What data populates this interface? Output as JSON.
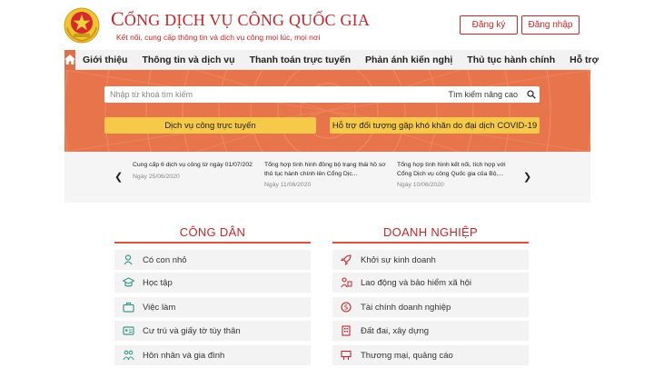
{
  "header": {
    "title_first": "C",
    "title_rest": "ỔNG DỊCH VỤ CÔNG QUỐC GIA",
    "subtitle": "Kết nối, cung cấp thông tin và dịch vụ công mọi lúc, mọi nơi",
    "register_label": "Đăng ký",
    "login_label": "Đăng nhập"
  },
  "nav": {
    "items": [
      "Giới thiệu",
      "Thông tin và dịch vụ",
      "Thanh toán trực tuyến",
      "Phản ánh kiến nghị",
      "Thủ tục hành chính",
      "Hỗ trợ"
    ]
  },
  "search": {
    "placeholder": "Nhập từ khoá tìm kiếm",
    "advanced_label": "Tìm kiếm nâng cao"
  },
  "hero_buttons": [
    "Dịch vụ công trực tuyến",
    "Hỗ trợ đối tượng gặp khó khăn do đại dịch COVID-19"
  ],
  "news": [
    {
      "title": "Cung cấp 6 dịch vụ công từ ngày 01/07/202",
      "date": "Ngày 25/06/2020"
    },
    {
      "title": "Tổng hợp tình hình đồng bộ trạng thái hồ sơ thủ tục hành chính lên Cổng Dịc...",
      "date": "Ngày 11/06/2020"
    },
    {
      "title": "Tổng hợp tình hình kết nối, tích hợp với Cổng Dịch vụ công Quốc gia của Bộ,...",
      "date": "Ngày 10/06/2020"
    }
  ],
  "citizen": {
    "title": "CÔNG DÂN",
    "items": [
      {
        "label": "Có con nhỏ",
        "icon": "baby-icon"
      },
      {
        "label": "Học tập",
        "icon": "graduation-cap-icon"
      },
      {
        "label": "Việc làm",
        "icon": "briefcase-icon"
      },
      {
        "label": "Cư trú và giấy tờ tùy thân",
        "icon": "id-card-icon"
      },
      {
        "label": "Hôn nhân và gia đình",
        "icon": "family-icon"
      }
    ]
  },
  "business": {
    "title": "DOANH NGHIỆP",
    "items": [
      {
        "label": "Khởi sự kinh doanh",
        "icon": "rocket-icon"
      },
      {
        "label": "Lao động và bảo hiểm xã hội",
        "icon": "worker-icon"
      },
      {
        "label": "Tài chính doanh nghiệp",
        "icon": "money-icon"
      },
      {
        "label": "Đất đai, xây dựng",
        "icon": "building-icon"
      },
      {
        "label": "Thương mại, quảng cáo",
        "icon": "billboard-icon"
      }
    ]
  },
  "colors": {
    "brand_red": "#c5262a",
    "hero_orange": "#e8744c",
    "button_yellow": "#f7c948",
    "section_rule": "#d9533a",
    "icon_teal": "#3a9a8c"
  }
}
